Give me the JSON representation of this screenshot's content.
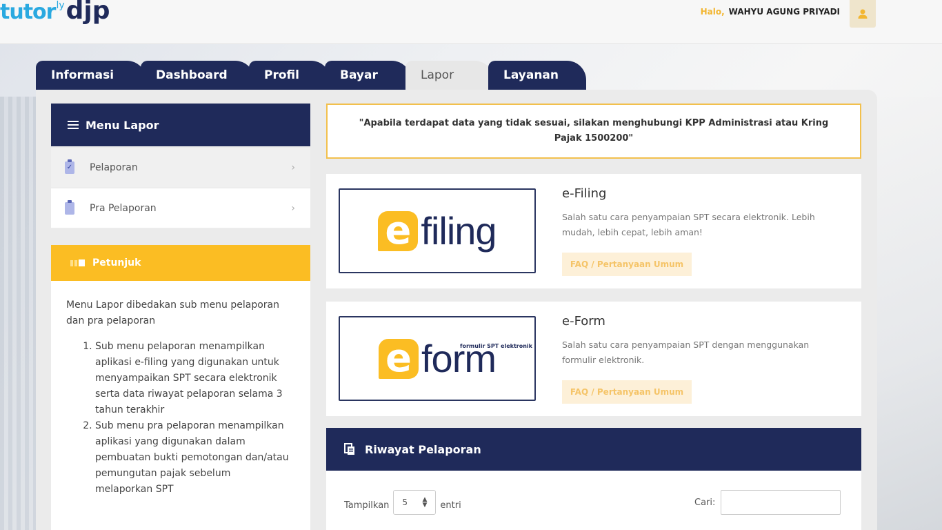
{
  "header": {
    "logo_tutor": "tutor",
    "logo_ly": "ly",
    "logo_djp": "djp",
    "greeting": "Halo,",
    "username": "WAHYU AGUNG PRIYADI"
  },
  "tabs": [
    {
      "label": "Informasi"
    },
    {
      "label": "Dashboard"
    },
    {
      "label": "Profil"
    },
    {
      "label": "Bayar"
    },
    {
      "label": "Lapor"
    },
    {
      "label": "Layanan"
    }
  ],
  "sidebar": {
    "menu_title": "Menu Lapor",
    "items": [
      {
        "label": "Pelaporan"
      },
      {
        "label": "Pra Pelaporan"
      }
    ],
    "petunjuk_title": "Petunjuk",
    "petunjuk_intro": "Menu Lapor dibedakan sub menu pelaporan dan pra pelaporan",
    "petunjuk_list": [
      "Sub menu pelaporan menampilkan aplikasi e-filing yang digunakan untuk menyampaikan SPT secara elektronik serta data riwayat pelaporan selama 3 tahun terakhir",
      "Sub menu pra pelaporan menampilkan aplikasi yang digunakan dalam pembuatan bukti pemotongan dan/atau pemungutan pajak sebelum melaporkan SPT"
    ]
  },
  "notice": "\"Apabila terdapat data yang tidak sesuai, silakan menghubungi KPP Administrasi atau Kring Pajak 1500200\"",
  "cards": [
    {
      "logo_letter": "e",
      "logo_word": "filing",
      "title": "e-Filing",
      "desc": "Salah satu cara penyampaian SPT secara elektronik. Lebih mudah, lebih cepat, lebih aman!",
      "faq": "FAQ / Pertanyaan Umum"
    },
    {
      "logo_letter": "e",
      "logo_word": "form",
      "logo_sub": "formulir SPT elektronik",
      "title": "e-Form",
      "desc": "Salah satu cara penyampaian SPT dengan menggunakan formulir elektronik.",
      "faq": "FAQ / Pertanyaan Umum"
    }
  ],
  "riwayat": {
    "title": "Riwayat Pelaporan",
    "show_label": "Tampilkan",
    "show_value": "5",
    "entries_label": "entri",
    "search_label": "Cari:",
    "search_value": ""
  },
  "colors": {
    "navy": "#1f2a5a",
    "yellow": "#fbbd23",
    "logo_blue": "#2aa9e0"
  }
}
